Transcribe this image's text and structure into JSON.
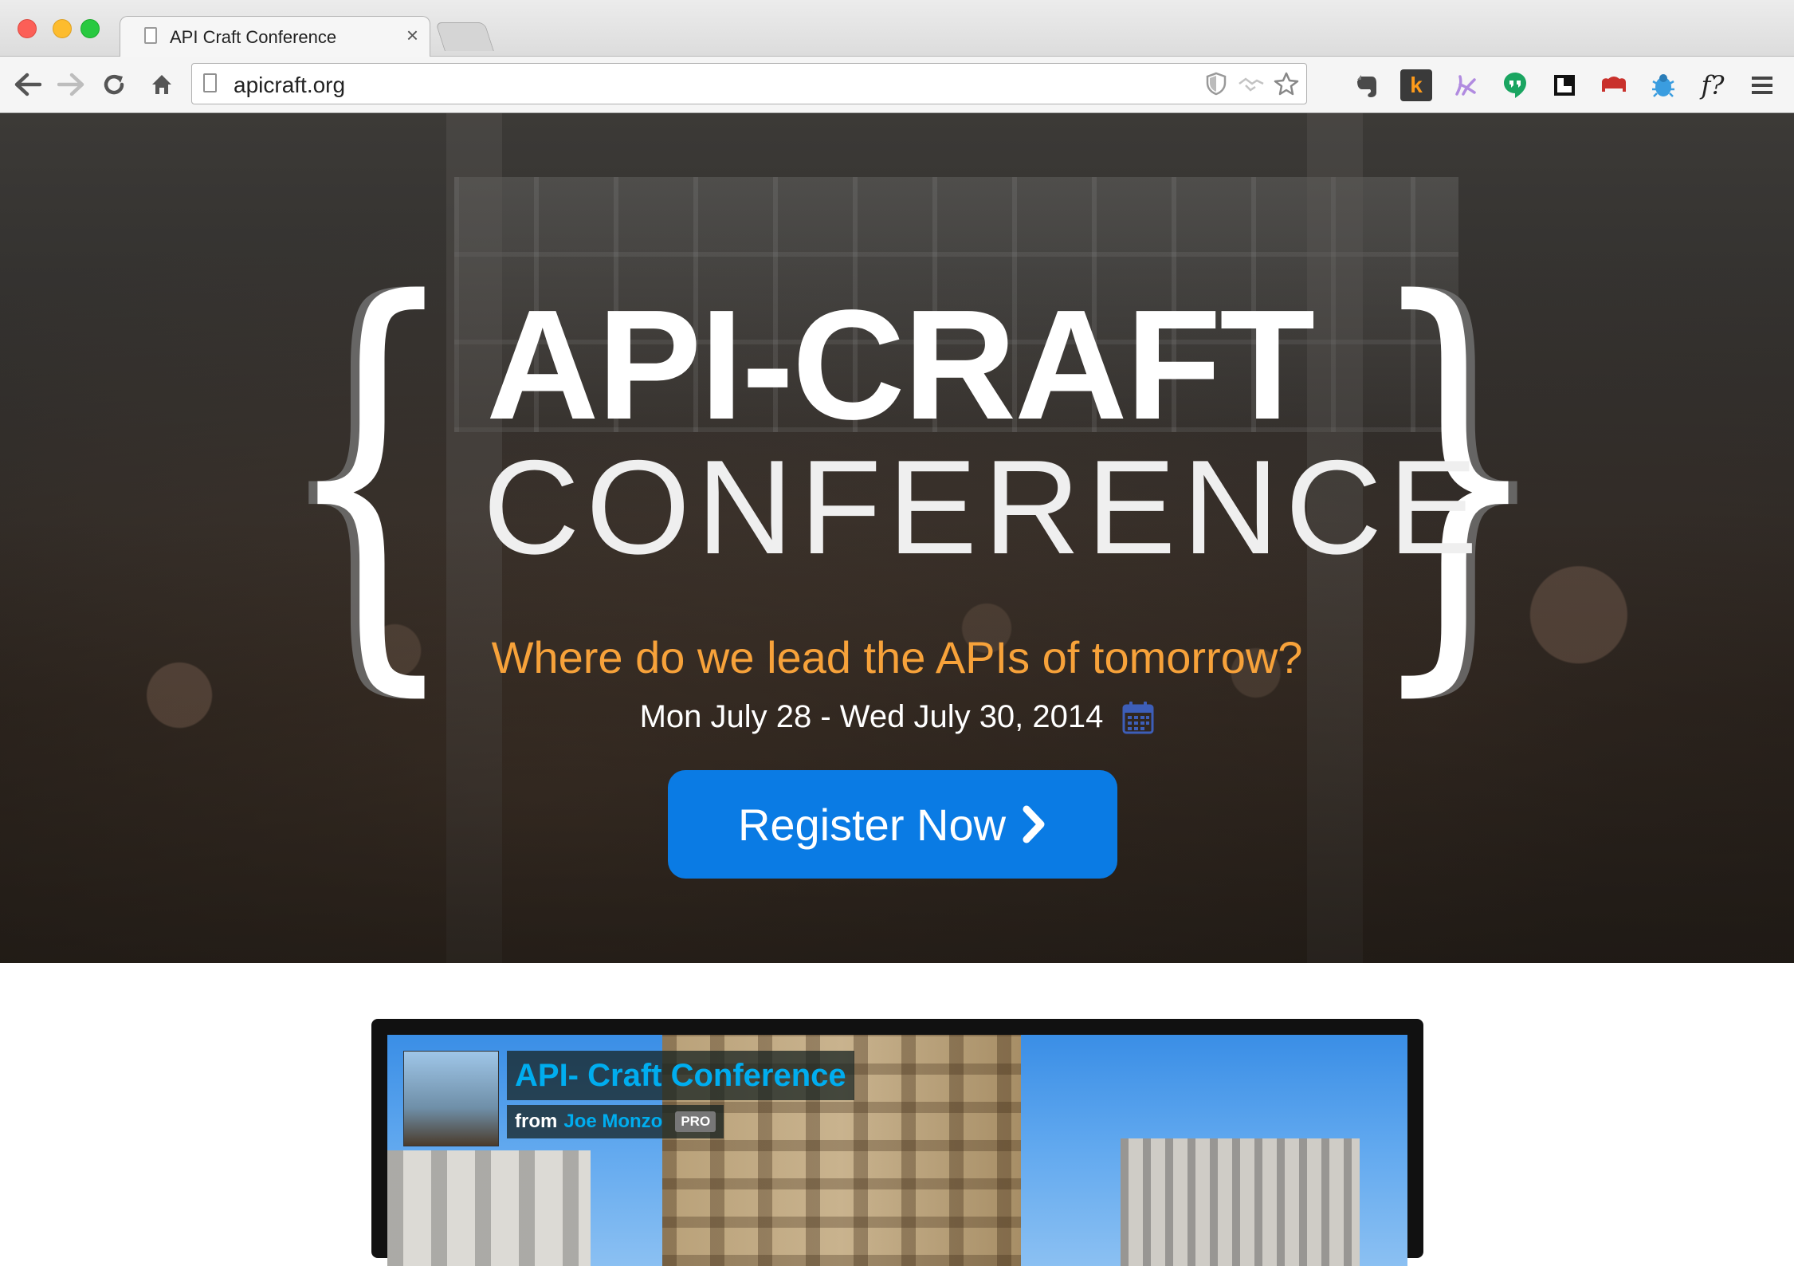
{
  "browser": {
    "tab_title": "API Craft Conference",
    "tab_close": "×",
    "url": "apicraft.org",
    "extensions": [
      "evernote-icon",
      "klout-icon",
      "hands-icon",
      "hangouts-icon",
      "pocket-icon",
      "couch-icon",
      "bug-icon",
      "font-identifier-icon",
      "menu-icon"
    ],
    "klout_letter": "k",
    "font_ext_label": "f?"
  },
  "hero": {
    "title": "API-CRAFT",
    "subtitle": "CONFERENCE",
    "tagline": "Where do we lead the APIs of tomorrow?",
    "dates": "Mon July 28 - Wed July 30, 2014",
    "register_label": "Register Now",
    "colors": {
      "tagline": "#f7a23a",
      "register_button": "#0a7be4"
    }
  },
  "video": {
    "title": "API- Craft Conference",
    "from_label": "from",
    "author": "Joe Monzo",
    "badge": "PRO",
    "colors": {
      "title": "#00adef"
    }
  }
}
